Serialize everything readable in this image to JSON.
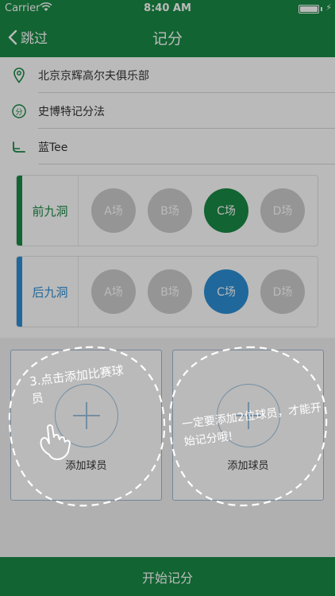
{
  "status_bar": {
    "carrier": "Carrier",
    "time": "8:40 AM"
  },
  "nav": {
    "back_label": "跳过",
    "title": "记分"
  },
  "info": {
    "course_name": "北京京辉高尔夫俱乐部",
    "scoring_method": "史博特记分法",
    "tee": "蓝Tee",
    "scoring_icon_text": "分"
  },
  "front_nine": {
    "label": "前九洞",
    "color": "#1a8a45",
    "courses": [
      "A场",
      "B场",
      "C场",
      "D场"
    ],
    "selected": "C场"
  },
  "back_nine": {
    "label": "后九洞",
    "color": "#2d8fd5",
    "courses": [
      "A场",
      "B场",
      "C场",
      "D场"
    ],
    "selected": "C场"
  },
  "players": {
    "add_label_1": "添加球员",
    "add_label_2": "添加球员"
  },
  "start_button": "开始记分",
  "guide": {
    "hint_1": "3.点击添加比赛球员",
    "hint_2": "一定要添加2位球员，才能开始记分哦!"
  },
  "colors": {
    "primary_green": "#1a8a45",
    "accent_blue": "#2d8fd5",
    "inactive_grey": "#cccccc"
  }
}
